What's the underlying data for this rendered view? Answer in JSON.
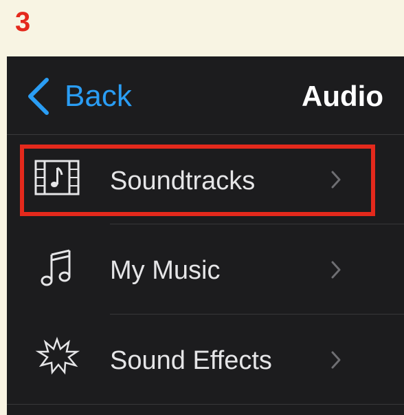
{
  "step": {
    "number": "3"
  },
  "nav": {
    "back_label": "Back",
    "title": "Audio"
  },
  "rows": [
    {
      "label": "Soundtracks",
      "icon": "film-music-icon"
    },
    {
      "label": "My Music",
      "icon": "music-note-icon"
    },
    {
      "label": "Sound Effects",
      "icon": "starburst-icon"
    }
  ],
  "colors": {
    "accent": "#2a9df4",
    "highlight": "#e4291c",
    "background": "#1c1c1e",
    "page_background": "#f8f4e3"
  }
}
